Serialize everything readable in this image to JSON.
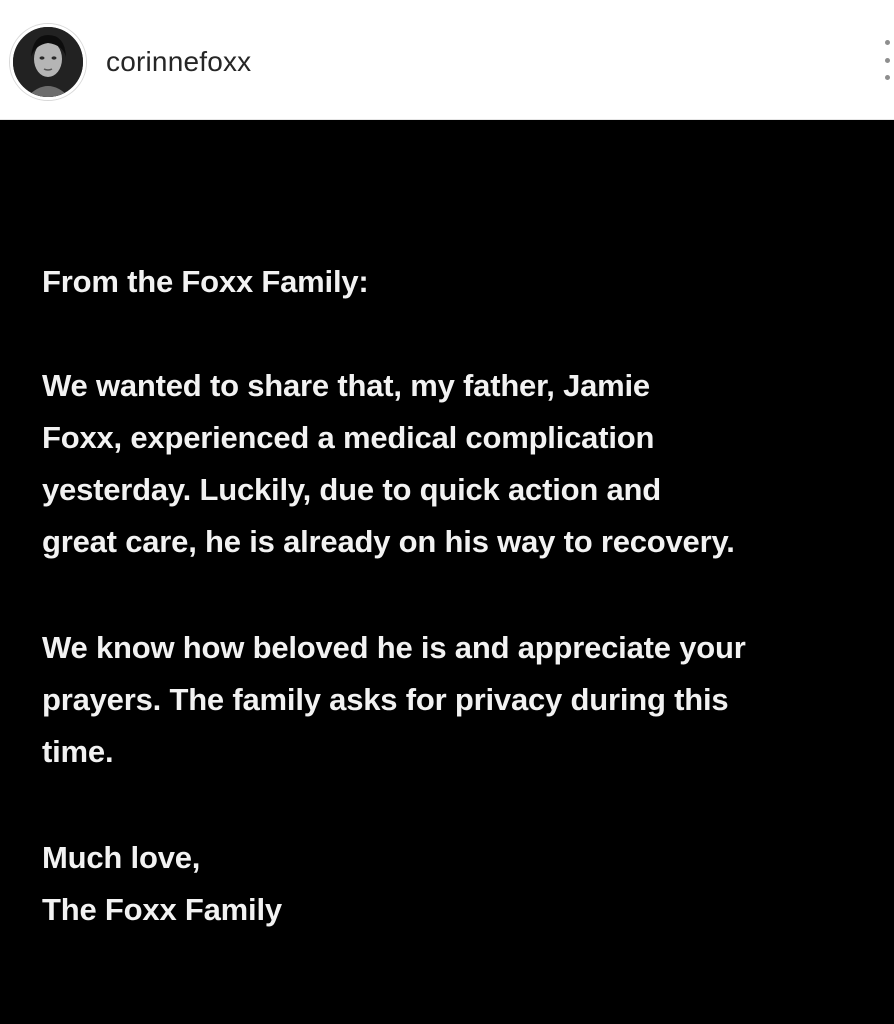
{
  "header": {
    "username": "corinnefoxx",
    "avatar_icon": "profile-photo",
    "menu_icon": "more-options-icon"
  },
  "post": {
    "heading": "From the Foxx Family:",
    "paragraph1": [
      "We wanted to share that, my father, Jamie",
      "Foxx, experienced a medical complication",
      "yesterday. Luckily, due to quick action and",
      "great care, he is already on his way to recovery."
    ],
    "paragraph2": [
      "We know how beloved he is and appreciate your",
      "prayers. The family asks for privacy during this",
      "time."
    ],
    "signoff": [
      "Much love,",
      "The Foxx Family"
    ]
  },
  "colors": {
    "header_bg": "#ffffff",
    "post_bg": "#000000",
    "text": "#f2f2f2",
    "username": "#262626"
  }
}
